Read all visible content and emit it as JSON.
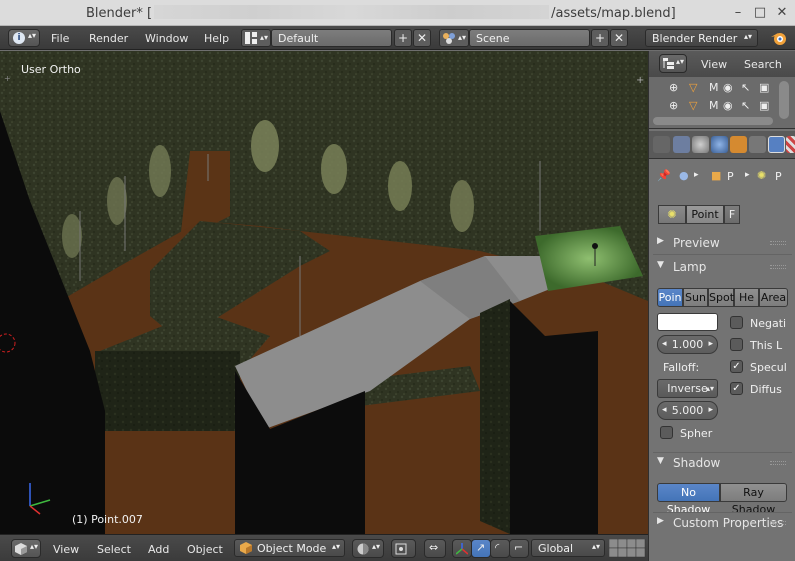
{
  "titlebar": {
    "app": "Blender*",
    "bracket": "[",
    "path_tail": "/assets/map.blend]",
    "minimize": "–",
    "maximize": "□",
    "close": "✕"
  },
  "header": {
    "menus": [
      "File",
      "Render",
      "Window",
      "Help"
    ],
    "screen_layout": "Default",
    "scene": "Scene",
    "engine": "Blender Render"
  },
  "viewport": {
    "view_label": "User Ortho",
    "object_label": "(1) Point.007"
  },
  "bottombar": {
    "menus": [
      "View",
      "Select",
      "Add",
      "Object"
    ],
    "mode": "Object Mode",
    "orientation": "Global"
  },
  "outliner": {
    "view_label": "View",
    "search_label": "Search",
    "rows": [
      "M",
      "M"
    ]
  },
  "properties": {
    "context_items": [
      "P",
      "P"
    ],
    "datablock_name": "Point",
    "fake_user": "F",
    "panels": {
      "preview": "Preview",
      "lamp": "Lamp",
      "shadow": "Shadow",
      "custom": "Custom Properties"
    },
    "lamp_types": [
      "Poin",
      "Sun",
      "Spot",
      "He",
      "Area"
    ],
    "lamp_type_selected": "Poin",
    "energy": "1.000",
    "falloff_label": "Falloff:",
    "falloff": "Inverse",
    "distance": "5.000",
    "options": {
      "negative": "Negati",
      "this_layer": "This L",
      "specular": "Specul",
      "diffuse": "Diffus",
      "sphere": "Spher"
    },
    "shadow_modes": [
      "No Shadow",
      "Ray Shadow"
    ],
    "colors": {
      "accent": "#5680c2",
      "lamp_color": "#ffffff"
    }
  }
}
